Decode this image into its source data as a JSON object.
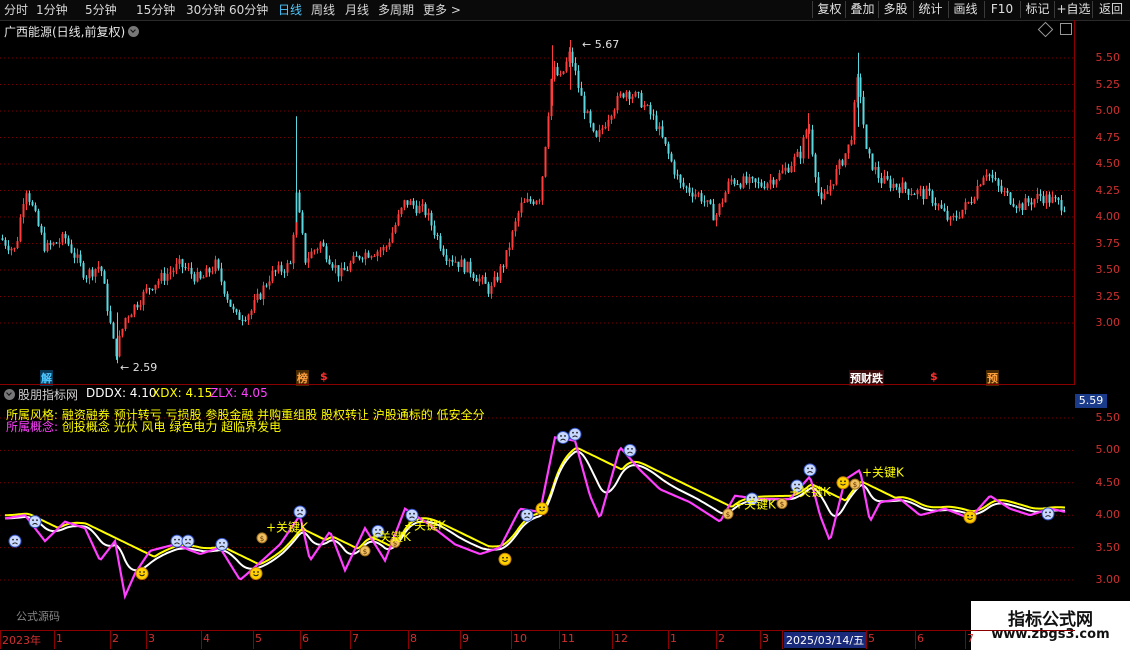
{
  "toolbar": {
    "periods": [
      "分时",
      "1分钟",
      "5分钟",
      "15分钟",
      "30分钟",
      "60分钟",
      "日线",
      "周线",
      "月线",
      "多周期",
      "更多"
    ],
    "active_period": "日线",
    "more_arrow": ">",
    "buttons": [
      "复权",
      "叠加",
      "多股",
      "统计",
      "画线",
      "F10",
      "标记",
      "+自选",
      "返回"
    ]
  },
  "main_chart": {
    "title": "广西能源(日线,前复权)",
    "price_axis": [
      "5.50",
      "5.25",
      "5.00",
      "4.75",
      "4.50",
      "4.25",
      "4.00",
      "3.75",
      "3.50",
      "3.25",
      "3.00"
    ],
    "high_label": "5.67",
    "low_label": "2.59",
    "tags": [
      {
        "text": "解",
        "color": "#4ec8ff"
      },
      {
        "text": "榜",
        "color": "#ffa040"
      },
      {
        "text": "$",
        "color": "#ff3030"
      },
      {
        "text": "预",
        "color": "#ff3030"
      },
      {
        "text": "龙",
        "color": "#ff3030"
      },
      {
        "text": "$",
        "color": "#ff3030"
      },
      {
        "text": "预",
        "color": "#ffa040"
      }
    ],
    "tag_label_prefix": "预财跌",
    "tag_label_text": "预财跌"
  },
  "indicator": {
    "name": "股朋指标网",
    "values": [
      {
        "label": "DDDX: 4.10",
        "color": "#ffffff"
      },
      {
        "label": "XDX: 4.15",
        "color": "#ffff00"
      },
      {
        "label": "ZLX: 4.05",
        "color": "#ff40ff"
      }
    ],
    "style_line": {
      "prefix": "所属风格:",
      "text": "融资融券 预计转亏 亏损股 参股金融 并购重组股 股权转让 沪股通标的 低安全分"
    },
    "concept_line": {
      "prefix": "所属概念:",
      "text": "创投概念 光伏 风电 绿色电力 超临界发电"
    },
    "axis": [
      "5.50",
      "5.00",
      "4.50",
      "4.00",
      "3.50",
      "3.00"
    ],
    "current_value": "5.59",
    "key_k_label": "关键K",
    "source_note": "公式源码"
  },
  "time_axis": {
    "labels": [
      "2023年",
      "1",
      "2",
      "3",
      "4",
      "5",
      "6",
      "7",
      "8",
      "9",
      "10",
      "11",
      "12",
      "1",
      "2",
      "3",
      "2025/03/14/五",
      "5",
      "6",
      "7"
    ],
    "selected": "2025/03/14/五"
  },
  "watermark": {
    "title": "指标公式网",
    "url": "www.zbgs3.com"
  },
  "colors": {
    "up": "#ff3c3c",
    "down": "#5ad8e0",
    "xdx": "#ffff00",
    "dddx": "#ffffff",
    "zlx": "#ff40ff",
    "grid": "#7a0000"
  }
}
